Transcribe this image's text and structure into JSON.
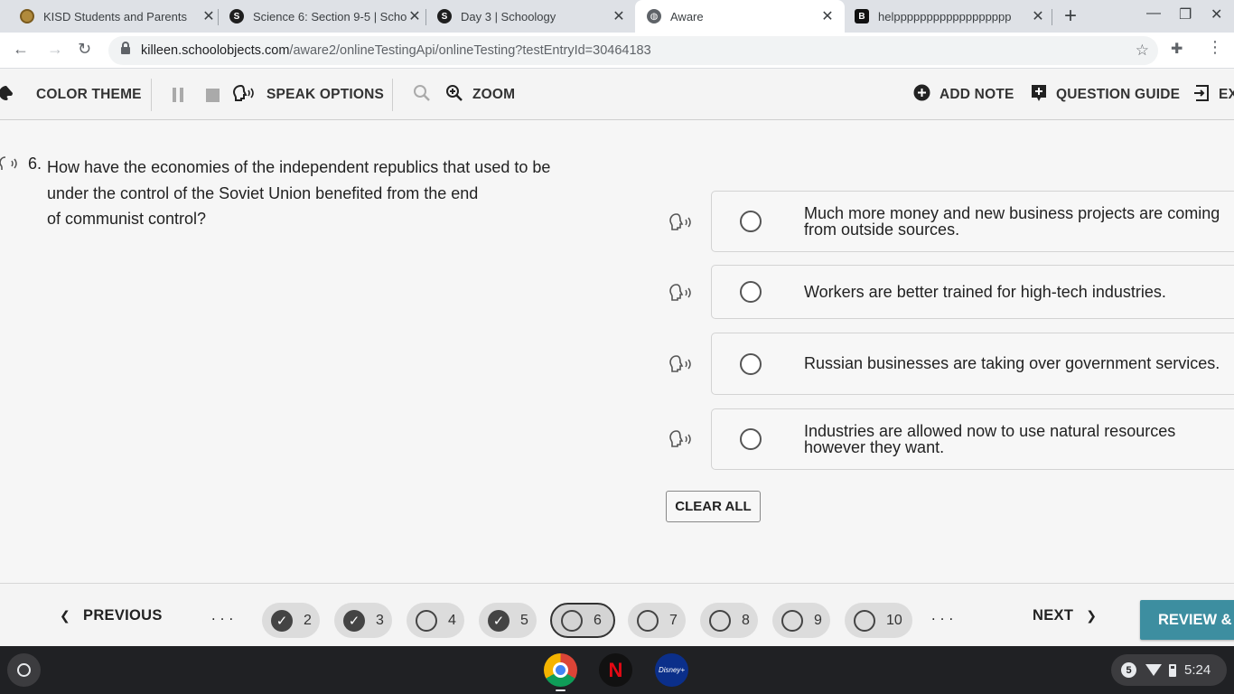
{
  "browser": {
    "tabs": [
      {
        "title": "KISD Students and Parents",
        "favicon": "kisd-seal-icon",
        "active": false
      },
      {
        "title": "Science 6: Section 9-5 | Schoology",
        "favicon": "schoology-icon",
        "active": false
      },
      {
        "title": "Day 3 | Schoology",
        "favicon": "schoology-icon",
        "active": false
      },
      {
        "title": "Aware",
        "favicon": "globe-icon",
        "active": true
      },
      {
        "title": "helpppppppppppppppppp",
        "favicon": "brainly-icon",
        "active": false
      }
    ],
    "new_tab_symbol": "+",
    "url_host": "killeen.schoolobjects.com",
    "url_path": "/aware2/onlineTestingApi/onlineTesting?testEntryId=30464183"
  },
  "app_toolbar": {
    "color_theme": "COLOR THEME",
    "speak_options": "SPEAK OPTIONS",
    "zoom": "ZOOM",
    "add_note": "ADD NOTE",
    "question_guide": "QUESTION GUIDE",
    "exit": "EX"
  },
  "question": {
    "number": "6.",
    "text": "How have the economies of the independent republics that used to be\nunder the control of the Soviet Union benefited from the end\nof communist control?"
  },
  "options": [
    {
      "text": "Much more money and new business projects are coming from outside sources.",
      "selected": false
    },
    {
      "text": "Workers are better trained for high-tech industries.",
      "selected": false
    },
    {
      "text": "Russian businesses are taking over government services.",
      "selected": false
    },
    {
      "text": "Industries are allowed now to use natural resources however they want.",
      "selected": false
    }
  ],
  "clear_all": "CLEAR ALL",
  "bottom_nav": {
    "previous": "PREVIOUS",
    "previous_chevron": "❮",
    "ellipsis_left": ". . .",
    "ellipsis_right": ". . .",
    "next": "NEXT",
    "next_chevron": "❯",
    "review": "REVIEW & S",
    "questions": [
      {
        "label": "2",
        "answered": true,
        "current": false
      },
      {
        "label": "3",
        "answered": true,
        "current": false
      },
      {
        "label": "4",
        "answered": false,
        "current": false
      },
      {
        "label": "5",
        "answered": true,
        "current": false
      },
      {
        "label": "6",
        "answered": false,
        "current": true
      },
      {
        "label": "7",
        "answered": false,
        "current": false
      },
      {
        "label": "8",
        "answered": false,
        "current": false
      },
      {
        "label": "9",
        "answered": false,
        "current": false
      },
      {
        "label": "10",
        "answered": false,
        "current": false
      }
    ]
  },
  "shelf": {
    "apps": [
      "chrome-icon",
      "netflix-icon",
      "disney-plus-icon"
    ],
    "netflix_letter": "N",
    "disney_label": "Disney+",
    "notification_count": "5",
    "time": "5:24"
  },
  "colors": {
    "review_button": "#3d8ea0",
    "shelf_background": "#202124"
  }
}
